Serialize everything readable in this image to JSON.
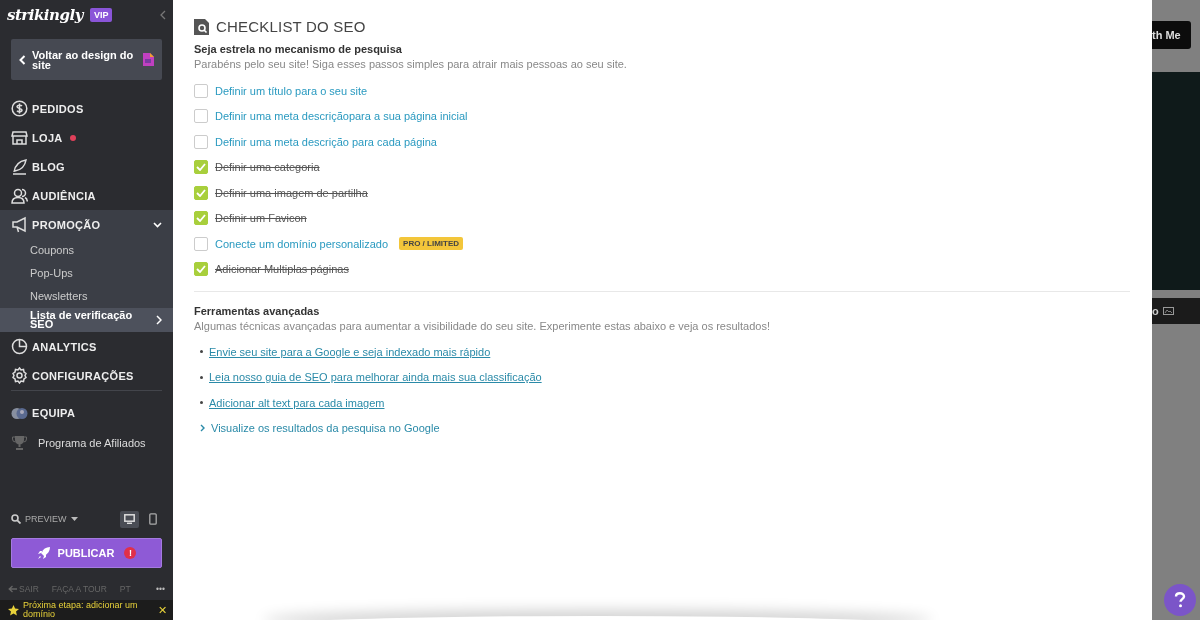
{
  "sidebar": {
    "logo": "strikingly",
    "badge": "VIP",
    "back_button": "Voltar ao design do site",
    "nav": [
      {
        "label": "PEDIDOS",
        "kind": "section",
        "alert": false,
        "divider_before": false
      },
      {
        "label": "LOJA",
        "kind": "section",
        "alert": true,
        "divider_before": false
      },
      {
        "label": "BLOG",
        "kind": "section",
        "alert": false,
        "divider_before": false
      },
      {
        "label": "AUDIÊNCIA",
        "kind": "section",
        "alert": false,
        "divider_before": false
      },
      {
        "label": "PROMOÇÃO",
        "kind": "section",
        "alert": false,
        "divider_before": false,
        "expanded": true,
        "children": [
          {
            "label": "Coupons",
            "selected": false
          },
          {
            "label": "Pop-Ups",
            "selected": false
          },
          {
            "label": "Newsletters",
            "selected": false
          },
          {
            "label": "Lista de verificação SEO",
            "selected": true
          }
        ]
      },
      {
        "label": "ANALYTICS",
        "kind": "section",
        "alert": false,
        "divider_before": false
      },
      {
        "label": "CONFIGURAÇÕES",
        "kind": "section",
        "alert": false,
        "divider_before": false
      },
      {
        "label": "EQUIPA",
        "kind": "section",
        "alert": false,
        "divider_before": true
      },
      {
        "label": "Programa de Afiliados",
        "kind": "plain",
        "alert": false,
        "divider_before": false
      }
    ],
    "preview": "PREVIEW",
    "devices": [
      {
        "kind": "desktop",
        "selected": true
      },
      {
        "kind": "mobile",
        "selected": false
      }
    ],
    "publish": {
      "label": "PUBLICAR",
      "alert": "!"
    },
    "footer": [
      "SAIR",
      "FAÇA A TOUR",
      "PT",
      "•••"
    ],
    "tip": {
      "text": "Próxima etapa: adicionar um domínio",
      "close": "✕"
    }
  },
  "main": {
    "title": "CHECKLIST DO SEO",
    "heading": "Seja estrela no mecanismo de pesquisa",
    "description": "Parabéns pelo seu site! Siga esses passos simples para atrair mais pessoas ao seu site.",
    "checklist": [
      {
        "label": "Definir um título para o seu site",
        "checked": false
      },
      {
        "label": "Definir uma meta descriçãopara a sua página inicial",
        "checked": false
      },
      {
        "label": "Definir uma meta descrição para cada página",
        "checked": false
      },
      {
        "label": "Definir uma categoria",
        "checked": true
      },
      {
        "label": "Definir uma imagem de partilha",
        "checked": true
      },
      {
        "label": "Definir um Favicon",
        "checked": true
      },
      {
        "label": "Conecte um domínio personalizado",
        "checked": false,
        "badge": "PRO / LIMITED"
      },
      {
        "label": "Adicionar Multiplas páginas",
        "checked": true
      }
    ],
    "tools_heading": "Ferramentas avançadas",
    "tools_description": "Algumas técnicas avançadas para aumentar a visibilidade do seu site. Experimente estas abaixo e veja os resultados!",
    "tools": [
      {
        "label": "Envie seu site para a Google e seja indexado mais rápido",
        "kind": "link"
      },
      {
        "label": "Leia nosso guia de SEO para melhorar ainda mais sua classificação",
        "kind": "link"
      },
      {
        "label": "Adicionar alt text para cada imagem",
        "kind": "link"
      },
      {
        "label": "Visualize os resultados da pesquisa no Google",
        "kind": "expander"
      }
    ]
  },
  "background": {
    "button": "th Me",
    "bar_text": "o"
  }
}
